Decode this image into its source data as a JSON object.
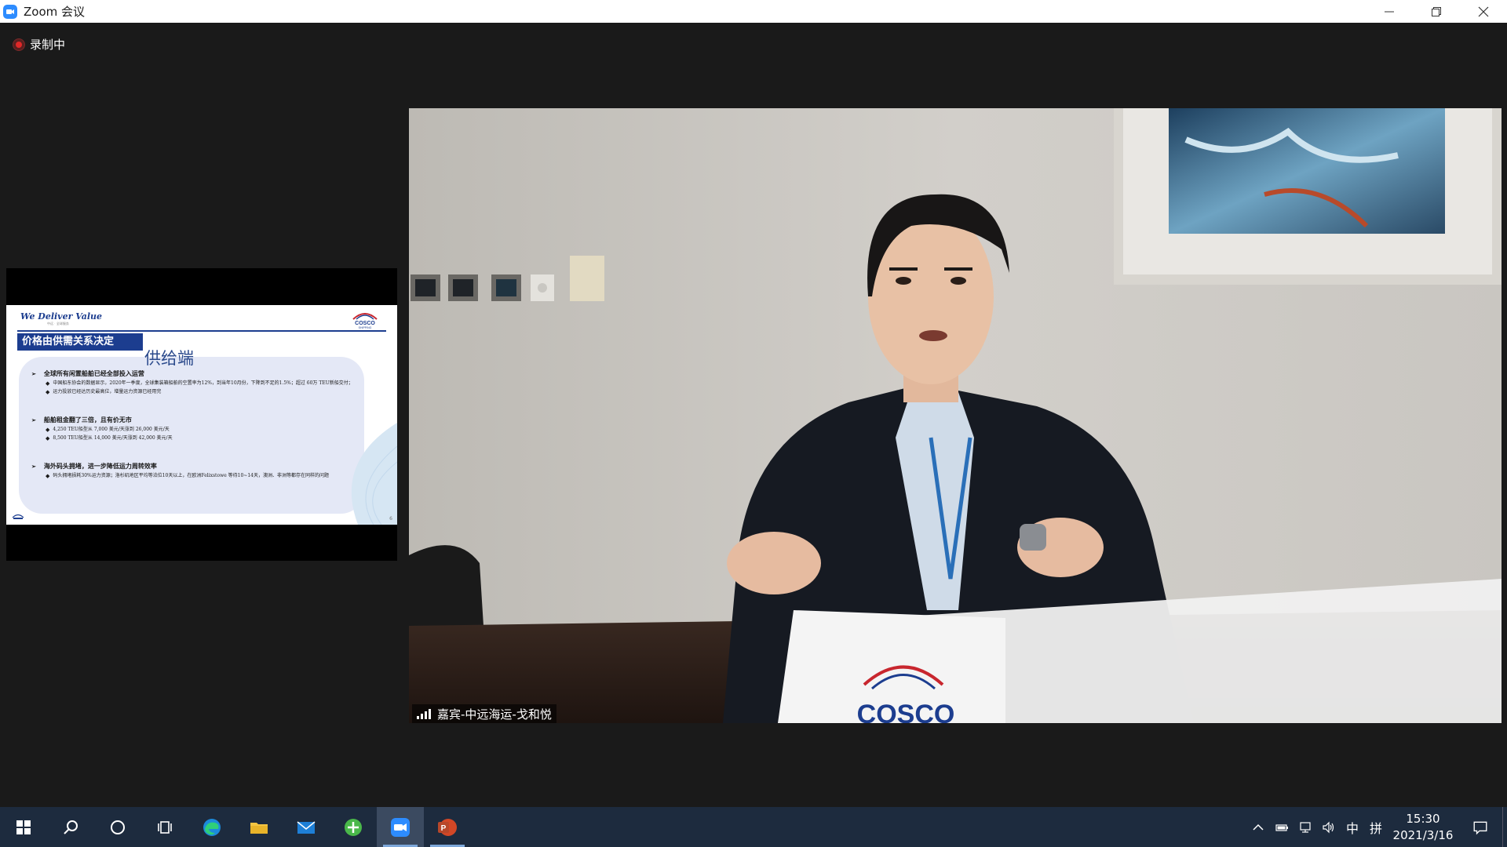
{
  "window": {
    "title": "Zoom 会议",
    "app_icon": "zoom-camera-icon",
    "controls": [
      "minimize-icon",
      "restore-icon",
      "close-icon"
    ]
  },
  "recording": {
    "label": "录制中",
    "color": "#e02828"
  },
  "shared_slide": {
    "logo_text": "We Deliver Value",
    "logo_sub": "中远 · 全球服务",
    "brand": "COSCO",
    "brand_sub": "SHIPPING",
    "title": "价格由供需关系决定",
    "heading": "供给端",
    "sections": [
      {
        "heading": "全球所有闲置船舶已经全部投入运营",
        "bullets": [
          "中国船东协会的数据显示，2020年一季度，全球集装箱船舶的空置率为12%，到当年10月份，下降到不足的1.5%；超过 60万 TEU新船交付；",
          "运力投放已经达历史最高位，增量运力资源已经用完"
        ]
      },
      {
        "heading": "船舶租金翻了三倍，且有价无市",
        "bullets": [
          "4,250 TEU船型从 7,000 美元/天涨到 26,000 美元/天",
          "8,500 TEU船型从 14,000 美元/天涨到 42,000 美元/天"
        ]
      },
      {
        "heading": "海外码头拥堵，进一步降低运力周转效率",
        "bullets": [
          "码头拥堵损耗30%运力资源；洛杉矶地区平均等泊位10天以上，在欧洲Felixstowe 等待10~14天，澳洲、非洲等都存在同样的问题"
        ]
      }
    ],
    "page_number": "6",
    "accent": "#1c3d8f"
  },
  "video": {
    "participant_name": "嘉宾-中远海运-戈和悦",
    "signal_icon": "signal-strength-icon"
  },
  "taskbar": {
    "items": [
      {
        "name": "start-icon"
      },
      {
        "name": "search-icon"
      },
      {
        "name": "cortana-icon"
      },
      {
        "name": "task-view-icon"
      },
      {
        "name": "edge-browser-icon"
      },
      {
        "name": "file-explorer-icon"
      },
      {
        "name": "mail-icon"
      },
      {
        "name": "green-app-icon"
      },
      {
        "name": "zoom-app-icon"
      },
      {
        "name": "powerpoint-icon"
      }
    ],
    "tray": {
      "ime": "中",
      "ime_mode": "拼",
      "time": "15:30",
      "date": "2021/3/16"
    }
  }
}
